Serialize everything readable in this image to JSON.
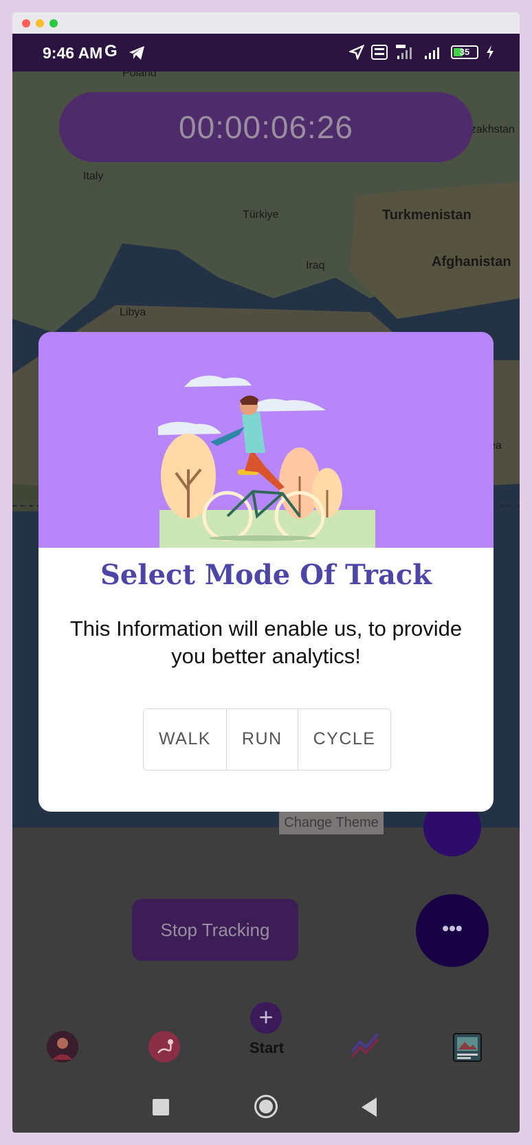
{
  "status": {
    "time": "9:46 AM",
    "google_glyph": "G",
    "battery": "35"
  },
  "map": {
    "labels": [
      {
        "text": "Poland",
        "style": "small"
      },
      {
        "text": "Italy",
        "style": "small"
      },
      {
        "text": "Türkiye",
        "style": "small"
      },
      {
        "text": "Turkmenistan",
        "style": "big"
      },
      {
        "text": "Afghanistan",
        "style": "big"
      },
      {
        "text": "Iraq",
        "style": "small"
      },
      {
        "text": "Libya",
        "style": "small"
      },
      {
        "text": "azakhstan",
        "style": "small"
      },
      {
        "text": "ea",
        "style": "small"
      }
    ]
  },
  "timer": "00:00:06:26",
  "dialog": {
    "title": "Select Mode Of Track",
    "message": "This Information will enable us, to provide you better analytics!",
    "options": [
      "WALK",
      "RUN",
      "CYCLE"
    ]
  },
  "theme_label": "Change Theme",
  "fab_more": "•••",
  "stop_button": "Stop Tracking",
  "nav": {
    "start_plus": "+",
    "start_label": "Start"
  },
  "colors": {
    "accent": "#4d45a8",
    "hero": "#b886fb",
    "timer_bg": "#4e2c6c",
    "fab": "#170144"
  }
}
